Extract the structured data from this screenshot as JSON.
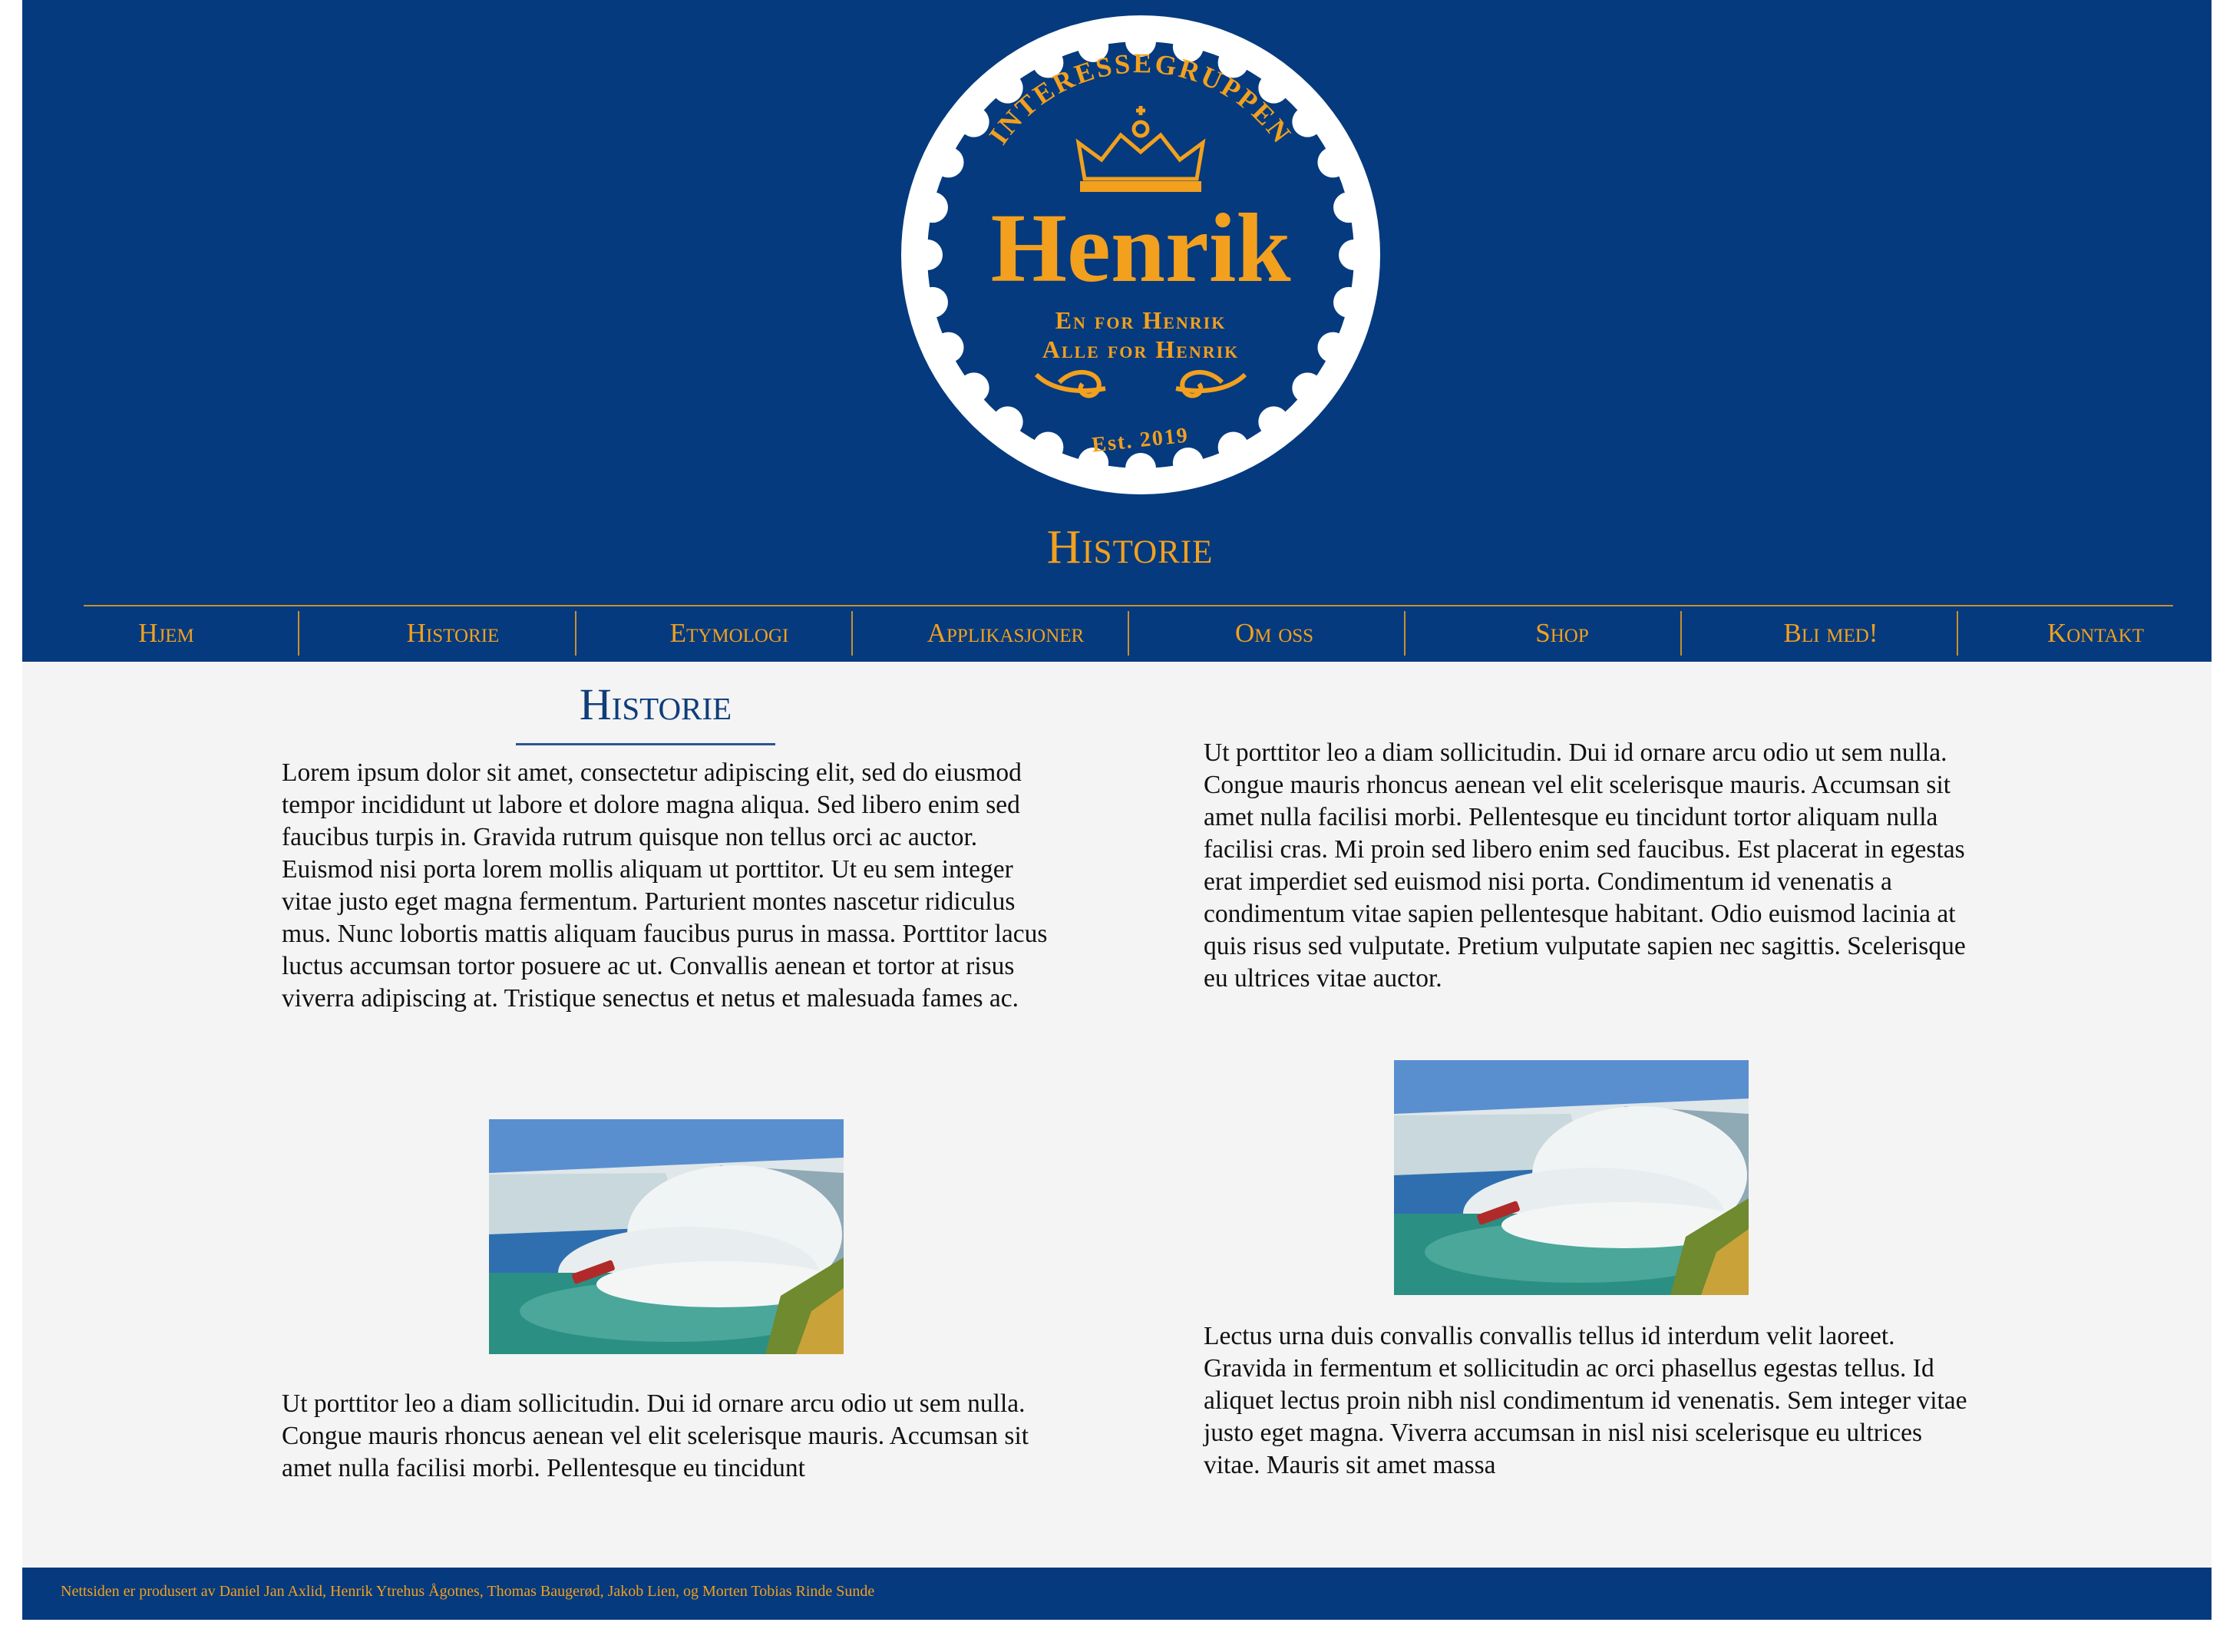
{
  "colors": {
    "navy": "#053a7e",
    "gold": "#f2a01e",
    "page_bg": "#f4f4f4"
  },
  "logo": {
    "arc_text": "INTERESSEGRUPPEN",
    "name": "Henrik",
    "motto_line1": "En for Henrik",
    "motto_line2": "Alle for Henrik",
    "established": "Est. 2019",
    "crown_icon": "crown-icon"
  },
  "header": {
    "page_title": "Historie"
  },
  "nav": {
    "items": [
      {
        "label": "Hjem"
      },
      {
        "label": "Historie"
      },
      {
        "label": "Etymologi"
      },
      {
        "label": "Applikasjoner"
      },
      {
        "label": "Om oss"
      },
      {
        "label": "Shop"
      },
      {
        "label": "Bli med!"
      },
      {
        "label": "Kontakt"
      }
    ]
  },
  "main": {
    "section_title": "Historie",
    "left": {
      "para1": "Lorem ipsum dolor sit amet, consectetur adipiscing elit, sed do eiusmod tempor incididunt ut labore et dolore magna aliqua. Sed libero enim sed faucibus turpis in. Gravida rutrum quisque non tellus orci ac auctor. Euismod nisi porta lorem mollis aliquam ut porttitor. Ut eu sem integer vitae justo eget magna fermentum. Parturient montes nascetur ridiculus mus. Nunc lobortis mattis aliquam faucibus purus in massa. Porttitor lacus luctus accumsan tortor posuere ac ut. Convallis aenean et tortor at risus viverra adipiscing at. Tristique senectus et netus et malesuada fames ac.",
      "para2": "Ut porttitor leo a diam sollicitudin. Dui id ornare arcu odio ut sem nulla. Congue mauris rhoncus aenean vel elit scelerisque mauris. Accumsan sit amet nulla facilisi morbi. Pellentesque eu tincidunt"
    },
    "right": {
      "para1": "Ut porttitor leo a diam sollicitudin. Dui id ornare arcu odio ut sem nulla. Congue mauris rhoncus aenean vel elit scelerisque mauris. Accumsan sit amet nulla facilisi morbi. Pellentesque eu tincidunt tortor aliquam nulla facilisi cras. Mi proin sed libero enim sed faucibus. Est placerat in egestas erat imperdiet sed euismod nisi porta. Condimentum id venenatis a condimentum vitae sapien pellentesque habitant. Odio euismod lacinia at quis risus sed vulputate. Pretium vulputate sapien nec sagittis. Scelerisque eu ultrices vitae auctor.",
      "para2": "Lectus urna duis convallis convallis tellus id interdum velit laoreet. Gravida in fermentum et sollicitudin ac orci phasellus egestas tellus. Id aliquet lectus proin nibh nisl condimentum id venenatis. Sem integer vitae justo eget magna. Viverra accumsan in nisl nisi scelerisque eu ultrices vitae. Mauris sit amet massa"
    }
  },
  "footer": {
    "credits": "Nettsiden er produsert av Daniel Jan Axlid, Henrik Ytrehus Ågotnes, Thomas Baugerød, Jakob Lien, og Morten Tobias Rinde Sunde"
  }
}
